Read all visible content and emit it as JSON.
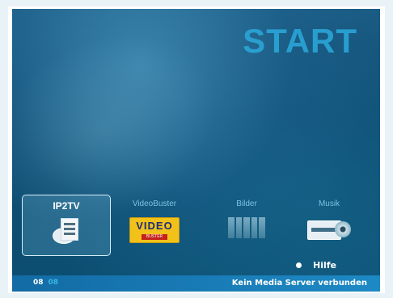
{
  "screen": {
    "title": "START"
  },
  "menu": [
    {
      "label": "IP2TV",
      "icon": "ip2tv-icon",
      "active": true
    },
    {
      "label": "VideoBuster",
      "icon": "videobuster-logo",
      "active": false
    },
    {
      "label": "Bilder",
      "icon": "pictures-icon",
      "active": false
    },
    {
      "label": "Musik",
      "icon": "music-icon",
      "active": false
    }
  ],
  "logo": {
    "word": "VIDEO",
    "sub": "BUSTER"
  },
  "help": {
    "label": "Hilfe"
  },
  "status_bar": {
    "hours": "08",
    "minutes": "08",
    "message": "Kein Media Server verbunden"
  },
  "colors": {
    "title": "#2aa6d8",
    "background": "#0f4d73",
    "status_bar": "#1e8cc8",
    "logo_yellow": "#f2c21a"
  }
}
